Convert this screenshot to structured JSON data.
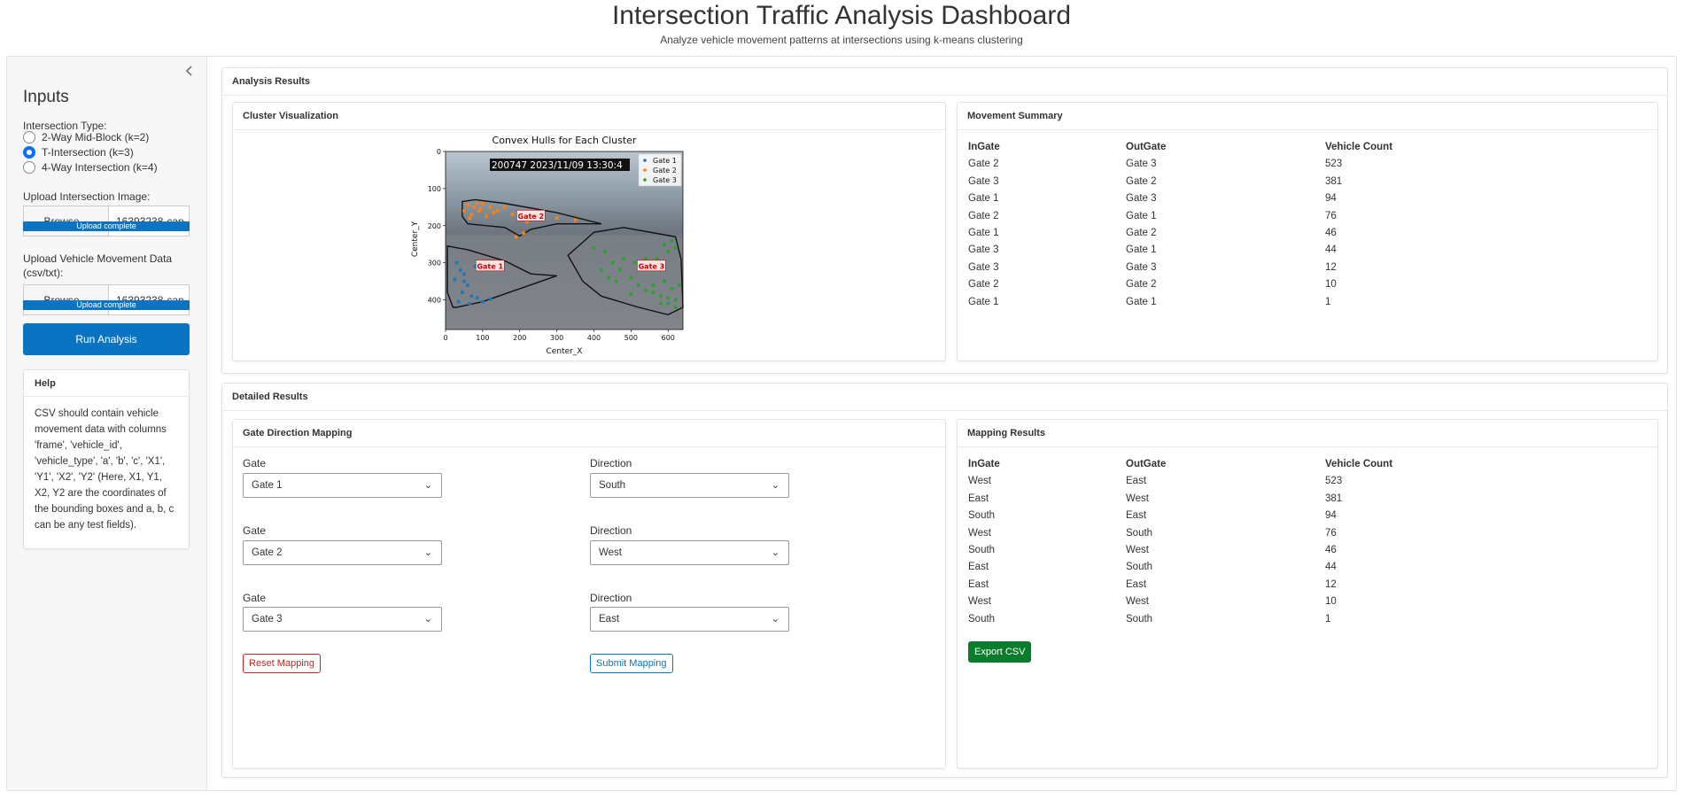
{
  "header": {
    "title": "Intersection Traffic Analysis Dashboard",
    "subtitle": "Analyze vehicle movement patterns at intersections using k-means clustering"
  },
  "sidebar": {
    "title": "Inputs",
    "collapse_icon": "chevron-left-icon",
    "intersection_label": "Intersection Type:",
    "options": [
      {
        "label": "2-Way Mid-Block (k=2)",
        "selected": false
      },
      {
        "label": "T-Intersection (k=3)",
        "selected": true
      },
      {
        "label": "4-Way Intersection (k=4)",
        "selected": false
      }
    ],
    "image_upload": {
      "label": "Upload Intersection Image:",
      "browse": "Browse...",
      "filename": "16393238-can",
      "status": "Upload complete"
    },
    "data_upload": {
      "label": "Upload Vehicle Movement Data (csv/txt):",
      "browse": "Browse...",
      "filename": "16393238-can",
      "status": "Upload complete"
    },
    "run_button": "Run Analysis",
    "help": {
      "title": "Help",
      "text": "CSV should contain vehicle movement data with columns 'frame', 'vehicle_id', 'vehicle_type', 'a', 'b', 'c', 'X1', 'Y1', 'X2', 'Y2' (Here, X1, Y1, X2, Y2 are the coordinates of the bounding boxes and a, b, c can be any test fields)."
    }
  },
  "analysis": {
    "title": "Analysis Results",
    "cluster_card": "Cluster Visualization",
    "summary_card": "Movement Summary",
    "columns": [
      "InGate",
      "OutGate",
      "Vehicle Count"
    ],
    "summary_rows": [
      [
        "Gate 2",
        "Gate 3",
        "523"
      ],
      [
        "Gate 3",
        "Gate 2",
        "381"
      ],
      [
        "Gate 1",
        "Gate 3",
        "94"
      ],
      [
        "Gate 2",
        "Gate 1",
        "76"
      ],
      [
        "Gate 1",
        "Gate 2",
        "46"
      ],
      [
        "Gate 3",
        "Gate 1",
        "44"
      ],
      [
        "Gate 3",
        "Gate 3",
        "12"
      ],
      [
        "Gate 2",
        "Gate 2",
        "10"
      ],
      [
        "Gate 1",
        "Gate 1",
        "1"
      ]
    ]
  },
  "chart_data": {
    "type": "scatter",
    "title": "Convex Hulls for Each Cluster",
    "xlabel": "Center_X",
    "ylabel": "Center_Y",
    "xlim": [
      0,
      640
    ],
    "ylim": [
      480,
      0
    ],
    "xticks": [
      "0",
      "100",
      "200",
      "300",
      "400",
      "500",
      "600"
    ],
    "yticks": [
      "0",
      "100",
      "200",
      "300",
      "400"
    ],
    "background_timestamp": "200747  2023/11/09  13:30:4",
    "legend_position": "upper right",
    "series": [
      {
        "name": "Gate 1",
        "color": "#1f77b4",
        "label": "Gate 1",
        "label_at": [
          120,
          310
        ],
        "hull": [
          [
            5,
            255
          ],
          [
            60,
            265
          ],
          [
            160,
            295
          ],
          [
            230,
            330
          ],
          [
            300,
            335
          ],
          [
            100,
            405
          ],
          [
            30,
            420
          ],
          [
            20,
            420
          ],
          [
            5,
            380
          ]
        ],
        "points": [
          [
            30,
            300
          ],
          [
            40,
            320
          ],
          [
            50,
            350
          ],
          [
            60,
            360
          ],
          [
            45,
            380
          ],
          [
            70,
            390
          ],
          [
            85,
            395
          ],
          [
            35,
            405
          ],
          [
            65,
            410
          ],
          [
            100,
            405
          ],
          [
            120,
            398
          ],
          [
            50,
            330
          ],
          [
            80,
            310
          ],
          [
            25,
            345
          ]
        ]
      },
      {
        "name": "Gate 2",
        "color": "#ff7f0e",
        "label": "Gate 2",
        "label_at": [
          230,
          175
        ],
        "hull": [
          [
            45,
            135
          ],
          [
            80,
            130
          ],
          [
            160,
            140
          ],
          [
            300,
            165
          ],
          [
            420,
            195
          ],
          [
            300,
            195
          ],
          [
            230,
            210
          ],
          [
            200,
            228
          ],
          [
            160,
            205
          ],
          [
            60,
            195
          ],
          [
            45,
            175
          ]
        ],
        "points": [
          [
            60,
            145
          ],
          [
            75,
            150
          ],
          [
            90,
            160
          ],
          [
            100,
            140
          ],
          [
            120,
            150
          ],
          [
            140,
            160
          ],
          [
            160,
            150
          ],
          [
            180,
            170
          ],
          [
            200,
            180
          ],
          [
            220,
            190
          ],
          [
            50,
            160
          ],
          [
            70,
            170
          ],
          [
            110,
            175
          ],
          [
            130,
            165
          ],
          [
            85,
            140
          ],
          [
            95,
            155
          ],
          [
            190,
            230
          ],
          [
            210,
            220
          ],
          [
            260,
            170
          ],
          [
            300,
            180
          ],
          [
            350,
            185
          ],
          [
            65,
            180
          ]
        ]
      },
      {
        "name": "Gate 3",
        "color": "#2ca02c",
        "label": "Gate 3",
        "label_at": [
          555,
          310
        ],
        "hull": [
          [
            330,
            280
          ],
          [
            400,
            218
          ],
          [
            480,
            205
          ],
          [
            620,
            230
          ],
          [
            635,
            290
          ],
          [
            640,
            420
          ],
          [
            600,
            440
          ],
          [
            520,
            420
          ],
          [
            420,
            390
          ],
          [
            370,
            350
          ]
        ],
        "points": [
          [
            400,
            260
          ],
          [
            430,
            270
          ],
          [
            450,
            300
          ],
          [
            470,
            320
          ],
          [
            500,
            340
          ],
          [
            520,
            360
          ],
          [
            540,
            375
          ],
          [
            560,
            380
          ],
          [
            580,
            390
          ],
          [
            600,
            395
          ],
          [
            620,
            400
          ],
          [
            610,
            370
          ],
          [
            590,
            350
          ],
          [
            560,
            320
          ],
          [
            570,
            290
          ],
          [
            600,
            270
          ],
          [
            620,
            260
          ],
          [
            610,
            240
          ],
          [
            590,
            250
          ],
          [
            540,
            290
          ],
          [
            510,
            300
          ],
          [
            480,
            290
          ],
          [
            460,
            350
          ],
          [
            440,
            340
          ],
          [
            420,
            320
          ],
          [
            620,
            420
          ],
          [
            600,
            410
          ],
          [
            580,
            410
          ],
          [
            630,
            360
          ],
          [
            560,
            360
          ],
          [
            500,
            385
          ]
        ]
      }
    ]
  },
  "detailed": {
    "title": "Detailed Results",
    "mapping_card": "Gate Direction Mapping",
    "gate_label": "Gate",
    "direction_label": "Direction",
    "mappings": [
      {
        "gate": "Gate 1",
        "direction": "South"
      },
      {
        "gate": "Gate 2",
        "direction": "West"
      },
      {
        "gate": "Gate 3",
        "direction": "East"
      }
    ],
    "reset_button": "Reset Mapping",
    "submit_button": "Submit Mapping",
    "results_card": "Mapping Results",
    "columns": [
      "InGate",
      "OutGate",
      "Vehicle Count"
    ],
    "result_rows": [
      [
        "West",
        "East",
        "523"
      ],
      [
        "East",
        "West",
        "381"
      ],
      [
        "South",
        "East",
        "94"
      ],
      [
        "West",
        "South",
        "76"
      ],
      [
        "South",
        "West",
        "46"
      ],
      [
        "East",
        "South",
        "44"
      ],
      [
        "East",
        "East",
        "12"
      ],
      [
        "West",
        "West",
        "10"
      ],
      [
        "South",
        "South",
        "1"
      ]
    ],
    "export_button": "Export CSV"
  }
}
